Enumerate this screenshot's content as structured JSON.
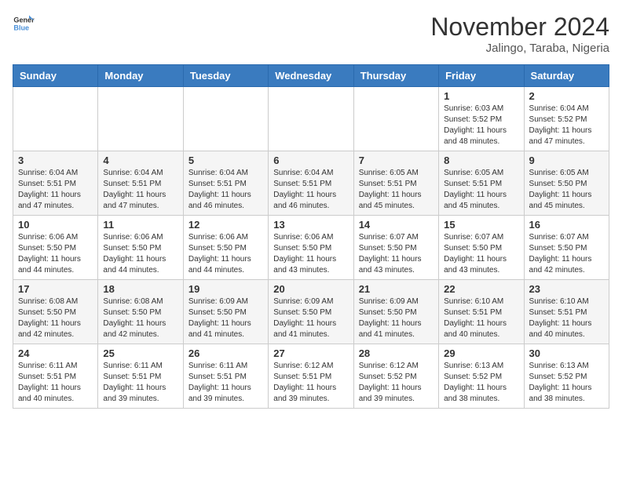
{
  "header": {
    "logo_line1": "General",
    "logo_line2": "Blue",
    "month_title": "November 2024",
    "location": "Jalingo, Taraba, Nigeria"
  },
  "weekdays": [
    "Sunday",
    "Monday",
    "Tuesday",
    "Wednesday",
    "Thursday",
    "Friday",
    "Saturday"
  ],
  "weeks": [
    [
      {
        "day": "",
        "info": ""
      },
      {
        "day": "",
        "info": ""
      },
      {
        "day": "",
        "info": ""
      },
      {
        "day": "",
        "info": ""
      },
      {
        "day": "",
        "info": ""
      },
      {
        "day": "1",
        "info": "Sunrise: 6:03 AM\nSunset: 5:52 PM\nDaylight: 11 hours\nand 48 minutes."
      },
      {
        "day": "2",
        "info": "Sunrise: 6:04 AM\nSunset: 5:52 PM\nDaylight: 11 hours\nand 47 minutes."
      }
    ],
    [
      {
        "day": "3",
        "info": "Sunrise: 6:04 AM\nSunset: 5:51 PM\nDaylight: 11 hours\nand 47 minutes."
      },
      {
        "day": "4",
        "info": "Sunrise: 6:04 AM\nSunset: 5:51 PM\nDaylight: 11 hours\nand 47 minutes."
      },
      {
        "day": "5",
        "info": "Sunrise: 6:04 AM\nSunset: 5:51 PM\nDaylight: 11 hours\nand 46 minutes."
      },
      {
        "day": "6",
        "info": "Sunrise: 6:04 AM\nSunset: 5:51 PM\nDaylight: 11 hours\nand 46 minutes."
      },
      {
        "day": "7",
        "info": "Sunrise: 6:05 AM\nSunset: 5:51 PM\nDaylight: 11 hours\nand 45 minutes."
      },
      {
        "day": "8",
        "info": "Sunrise: 6:05 AM\nSunset: 5:51 PM\nDaylight: 11 hours\nand 45 minutes."
      },
      {
        "day": "9",
        "info": "Sunrise: 6:05 AM\nSunset: 5:50 PM\nDaylight: 11 hours\nand 45 minutes."
      }
    ],
    [
      {
        "day": "10",
        "info": "Sunrise: 6:06 AM\nSunset: 5:50 PM\nDaylight: 11 hours\nand 44 minutes."
      },
      {
        "day": "11",
        "info": "Sunrise: 6:06 AM\nSunset: 5:50 PM\nDaylight: 11 hours\nand 44 minutes."
      },
      {
        "day": "12",
        "info": "Sunrise: 6:06 AM\nSunset: 5:50 PM\nDaylight: 11 hours\nand 44 minutes."
      },
      {
        "day": "13",
        "info": "Sunrise: 6:06 AM\nSunset: 5:50 PM\nDaylight: 11 hours\nand 43 minutes."
      },
      {
        "day": "14",
        "info": "Sunrise: 6:07 AM\nSunset: 5:50 PM\nDaylight: 11 hours\nand 43 minutes."
      },
      {
        "day": "15",
        "info": "Sunrise: 6:07 AM\nSunset: 5:50 PM\nDaylight: 11 hours\nand 43 minutes."
      },
      {
        "day": "16",
        "info": "Sunrise: 6:07 AM\nSunset: 5:50 PM\nDaylight: 11 hours\nand 42 minutes."
      }
    ],
    [
      {
        "day": "17",
        "info": "Sunrise: 6:08 AM\nSunset: 5:50 PM\nDaylight: 11 hours\nand 42 minutes."
      },
      {
        "day": "18",
        "info": "Sunrise: 6:08 AM\nSunset: 5:50 PM\nDaylight: 11 hours\nand 42 minutes."
      },
      {
        "day": "19",
        "info": "Sunrise: 6:09 AM\nSunset: 5:50 PM\nDaylight: 11 hours\nand 41 minutes."
      },
      {
        "day": "20",
        "info": "Sunrise: 6:09 AM\nSunset: 5:50 PM\nDaylight: 11 hours\nand 41 minutes."
      },
      {
        "day": "21",
        "info": "Sunrise: 6:09 AM\nSunset: 5:50 PM\nDaylight: 11 hours\nand 41 minutes."
      },
      {
        "day": "22",
        "info": "Sunrise: 6:10 AM\nSunset: 5:51 PM\nDaylight: 11 hours\nand 40 minutes."
      },
      {
        "day": "23",
        "info": "Sunrise: 6:10 AM\nSunset: 5:51 PM\nDaylight: 11 hours\nand 40 minutes."
      }
    ],
    [
      {
        "day": "24",
        "info": "Sunrise: 6:11 AM\nSunset: 5:51 PM\nDaylight: 11 hours\nand 40 minutes."
      },
      {
        "day": "25",
        "info": "Sunrise: 6:11 AM\nSunset: 5:51 PM\nDaylight: 11 hours\nand 39 minutes."
      },
      {
        "day": "26",
        "info": "Sunrise: 6:11 AM\nSunset: 5:51 PM\nDaylight: 11 hours\nand 39 minutes."
      },
      {
        "day": "27",
        "info": "Sunrise: 6:12 AM\nSunset: 5:51 PM\nDaylight: 11 hours\nand 39 minutes."
      },
      {
        "day": "28",
        "info": "Sunrise: 6:12 AM\nSunset: 5:52 PM\nDaylight: 11 hours\nand 39 minutes."
      },
      {
        "day": "29",
        "info": "Sunrise: 6:13 AM\nSunset: 5:52 PM\nDaylight: 11 hours\nand 38 minutes."
      },
      {
        "day": "30",
        "info": "Sunrise: 6:13 AM\nSunset: 5:52 PM\nDaylight: 11 hours\nand 38 minutes."
      }
    ]
  ]
}
